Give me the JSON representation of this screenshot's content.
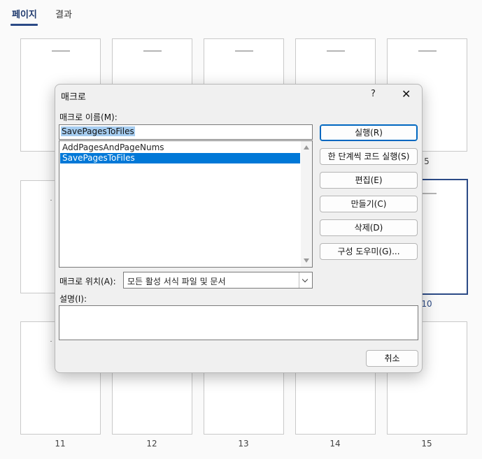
{
  "tabs": {
    "pages": "페이지",
    "results": "결과"
  },
  "thumbnail_numbers": {
    "p5": "5",
    "p10": "10",
    "p11": "11",
    "p12": "12",
    "p13": "13",
    "p14": "14",
    "p15": "15"
  },
  "selected_page": "10",
  "dialog": {
    "title": "매크로",
    "help": "?",
    "close": "✕",
    "macro_name_label": "매크로 이름(M):",
    "macro_name_value": "SavePagesToFiles",
    "macros": [
      "AddPagesAndPageNums",
      "SavePagesToFiles"
    ],
    "selected_macro": "SavePagesToFiles",
    "location_label": "매크로 위치(A):",
    "location_value": "모든 활성 서식 파일 및 문서",
    "description_label": "설명(I):",
    "buttons": {
      "run": "실행(R)",
      "step": "한 단계씩 코드 실행(S)",
      "edit": "편집(E)",
      "create": "만들기(C)",
      "delete": "삭제(D)",
      "organizer": "구성 도우미(G)...",
      "cancel": "취소"
    }
  },
  "colors": {
    "accent": "#2b4a86",
    "selection": "#0078d7",
    "highlight": "#a6cdf0"
  }
}
